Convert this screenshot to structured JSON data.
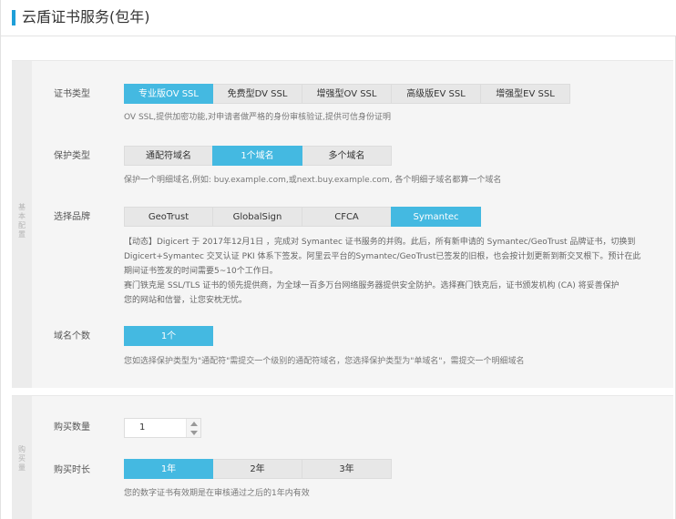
{
  "header": {
    "title": "云盾证书服务(包年)"
  },
  "section_a": {
    "side_label": "基本配置",
    "cert_type": {
      "label": "证书类型",
      "options": [
        "专业版OV SSL",
        "免费型DV SSL",
        "增强型OV SSL",
        "高级版EV SSL",
        "增强型EV SSL"
      ],
      "selected": 0,
      "hint": "OV SSL,提供加密功能,对申请者做严格的身份审核验证,提供可信身份证明"
    },
    "protect_type": {
      "label": "保护类型",
      "options": [
        "通配符域名",
        "1个域名",
        "多个域名"
      ],
      "selected": 1,
      "hint": "保护一个明细域名,例如: buy.example.com,或next.buy.example.com, 各个明细子域名都算一个域名"
    },
    "brand": {
      "label": "选择品牌",
      "options": [
        "GeoTrust",
        "GlobalSign",
        "CFCA",
        "Symantec"
      ],
      "selected": 3,
      "desc_lines": [
        "【动态】Digicert 于 2017年12月1日 ，完成对 Symantec 证书服务的并购。此后，所有新申请的 Symantec/GeoTrust 品牌证书，切换到",
        "Digicert+Symantec 交叉认证 PKI 体系下签发。阿里云平台的Symantec/GeoTrust已签发的旧根，也会按计划更新到新交叉根下。预计在此",
        "期间证书签发的时间需要5~10个工作日。",
        "赛门铁克是 SSL/TLS 证书的领先提供商，为全球一百多万台网络服务器提供安全防护。选择赛门铁克后，证书颁发机构 (CA) 将妥善保护",
        "您的网站和信誉，让您安枕无忧。"
      ]
    },
    "domain_count": {
      "label": "域名个数",
      "options": [
        "1个"
      ],
      "selected": 0,
      "hint": "您如选择保护类型为\"通配符\"需提交一个级别的通配符域名，您选择保护类型为\"单域名\"，需提交一个明细域名"
    }
  },
  "section_b": {
    "side_label": "购买量",
    "quantity": {
      "label": "购买数量",
      "value": "1"
    },
    "duration": {
      "label": "购买时长",
      "options": [
        "1年",
        "2年",
        "3年"
      ],
      "selected": 0,
      "hint": "您的数字证书有效期是在审核通过之后的1年内有效"
    }
  },
  "colors": {
    "accent": "#44b9e1",
    "title_bar": "#1e9fd8"
  }
}
